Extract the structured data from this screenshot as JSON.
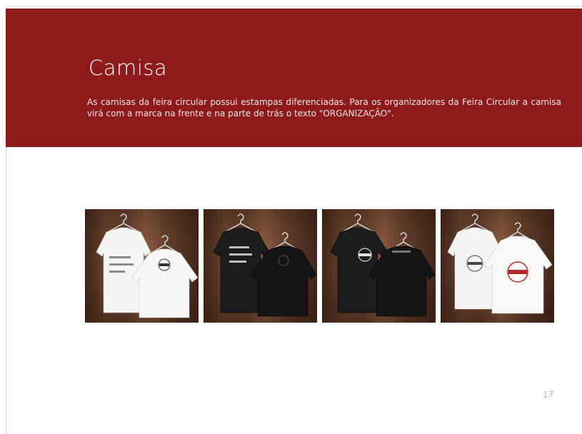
{
  "page": {
    "title": "Camisa",
    "description": "As camisas da feira circular possui estampas diferenciadas. Para os organizadores da Feira Circular a camisa virá com a marca na frente e na parte de trás o texto \"ORGANIZAÇÃO\".",
    "page_number": "17"
  },
  "colors": {
    "header_band": "#8e1a1c",
    "title_text": "#ffffff",
    "shirt_white": "#f4f4f2",
    "shirt_black": "#1c1c1c",
    "print_red": "#b3282a"
  },
  "gallery": {
    "photos": [
      {
        "name": "shirt-photo-white-text-and-logo",
        "front_shirt": "white",
        "back_shirt": "white",
        "print": "É A ARTE INVADINDO A RUA",
        "back_print": "logo"
      },
      {
        "name": "shirt-photo-black-text",
        "front_shirt": "black",
        "back_shirt": "black",
        "print": "É A ARTE INVADINDO A RUA",
        "back_print": "logo"
      },
      {
        "name": "shirt-photo-black-logo-organizacao",
        "front_shirt": "black",
        "back_shirt": "black",
        "print": "logo",
        "back_print": "ORGANIZAÇÃO"
      },
      {
        "name": "shirt-photo-white-logo-red",
        "front_shirt": "white",
        "back_shirt": "white",
        "print": "logo",
        "back_print": "logo-red"
      }
    ]
  }
}
